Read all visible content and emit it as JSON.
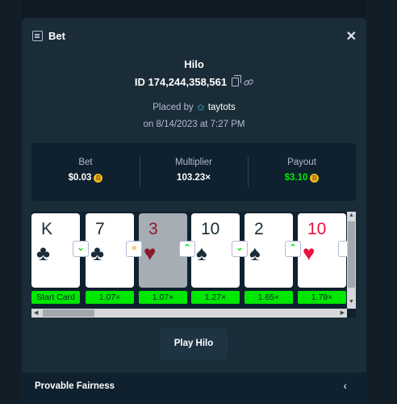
{
  "header": {
    "title": "Bet",
    "icon": "bet-slip-icon",
    "close_icon": "close-icon"
  },
  "game": {
    "name": "Hilo"
  },
  "bet": {
    "id": "ID 174,244,358,561",
    "placed_by_label": "Placed by",
    "user": "taytots",
    "date": "on 8/14/2023 at 7:27 PM"
  },
  "stats": {
    "bet_label": "Bet",
    "bet_value": "$0.03",
    "multiplier_label": "Multiplier",
    "multiplier_value": "103.23×",
    "payout_label": "Payout",
    "payout_value": "$3.10",
    "coin": "B"
  },
  "cards": [
    {
      "rank": "K",
      "suit": "♣",
      "color": "black",
      "label": "Start Card"
    },
    {
      "rank": "7",
      "suit": "♣",
      "color": "black",
      "guess": "⌄",
      "guess_type": "lower",
      "label": "1.07×"
    },
    {
      "rank": "3",
      "suit": "♥",
      "color": "dred",
      "guess": "»",
      "guess_type": "skip",
      "label": "1.07×",
      "skipped": true
    },
    {
      "rank": "10",
      "suit": "♠",
      "color": "black",
      "guess": "⌃",
      "guess_type": "higher",
      "label": "1.27×"
    },
    {
      "rank": "2",
      "suit": "♠",
      "color": "black",
      "guess": "⌄",
      "guess_type": "lower",
      "label": "1.65×"
    },
    {
      "rank": "10",
      "suit": "♥",
      "color": "red",
      "guess": "⌃",
      "guess_type": "higher",
      "label": "1.79×"
    }
  ],
  "actions": {
    "play_label": "Play Hilo"
  },
  "footer": {
    "label": "Provable Fairness",
    "chevron": "‹"
  },
  "colors": {
    "accent": "#00e701",
    "panel": "#1a2c38",
    "dark": "#0f212e"
  }
}
